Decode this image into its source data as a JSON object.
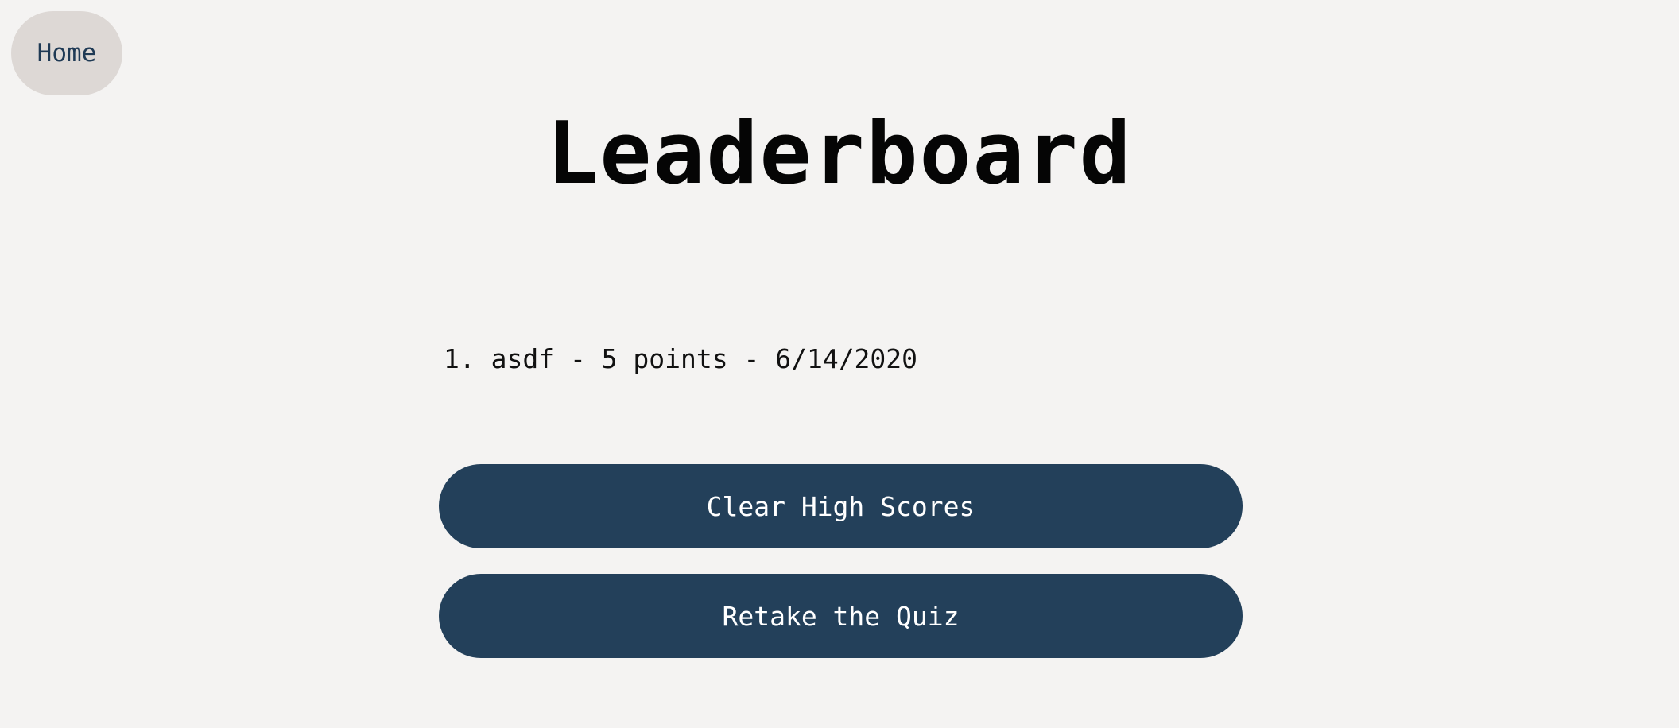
{
  "nav": {
    "home_label": "Home"
  },
  "page": {
    "title": "Leaderboard"
  },
  "scores": [
    {
      "text": "1. asdf - 5 points - 6/14/2020"
    }
  ],
  "actions": {
    "clear_label": "Clear High Scores",
    "retake_label": "Retake the Quiz"
  },
  "colors": {
    "background": "#f4f3f2",
    "home_button_bg": "#ddd8d5",
    "primary_button_bg": "#23405a",
    "title_text": "#050505"
  }
}
